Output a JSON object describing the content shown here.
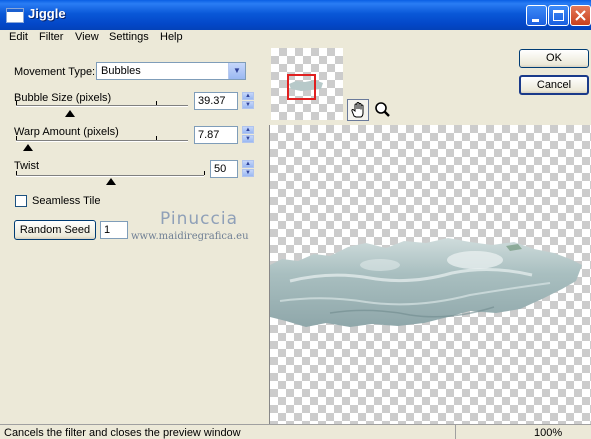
{
  "window": {
    "title": "Jiggle"
  },
  "menu": {
    "items": [
      "Edit",
      "Filter",
      "View",
      "Settings",
      "Help"
    ]
  },
  "controls": {
    "movement_type": {
      "label": "Movement Type:",
      "value": "Bubbles"
    },
    "bubble_size": {
      "label": "Bubble Size (pixels)",
      "value": "39.37"
    },
    "warp_amount": {
      "label": "Warp Amount (pixels)",
      "value": "7.87"
    },
    "twist": {
      "label": "Twist",
      "value": "50"
    },
    "seamless_tile": {
      "label": "Seamless Tile",
      "checked": false
    },
    "random_seed": {
      "label": "Random Seed",
      "value": "1"
    }
  },
  "buttons": {
    "ok": "OK",
    "cancel": "Cancel"
  },
  "watermark": {
    "line1": "Pinuccia",
    "line2": "www.maidiregrafica.eu"
  },
  "status": {
    "text": "Cancels the filter and closes the preview window",
    "zoom": "100%"
  },
  "icons": {
    "pan": "hand-icon",
    "zoom": "magnifier-icon"
  },
  "colors": {
    "titlebar": "#0a58d8",
    "navigator_frame": "#e02020"
  }
}
